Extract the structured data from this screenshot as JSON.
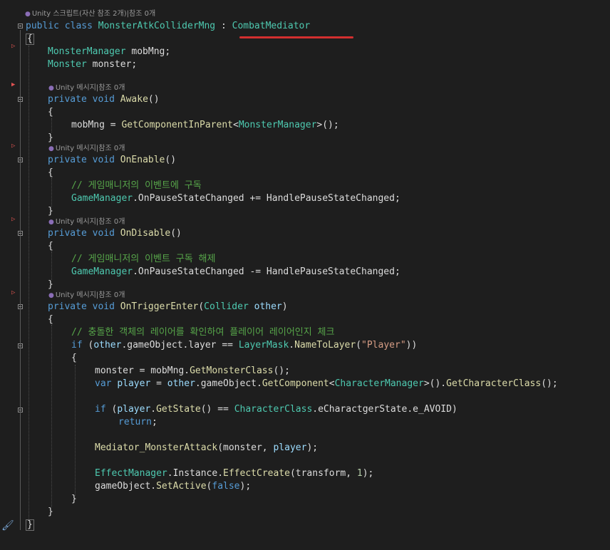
{
  "lens": {
    "script_unity": "Unity",
    "script_rest": "스크립트(자산 참조 2개)|참조 0개",
    "msg_unity": "Unity",
    "msg_rest": "메시지|참조 0개"
  },
  "code": {
    "kw_public": "public",
    "kw_class": "class",
    "class_name": "MonsterAtkColliderMng",
    "colon": " : ",
    "base_class": "CombatMediator",
    "brace_open": "{",
    "brace_close": "}",
    "t_monster_manager": "MonsterManager",
    "f_mobMng": " mobMng;",
    "t_monster": "Monster",
    "f_monster": " monster;",
    "kw_private": "private",
    "kw_void": "void",
    "m_awake": "Awake",
    "parens": "()",
    "awake_body_a": "mobMng = ",
    "awake_call": "GetComponentInParent",
    "lt": "<",
    "gt_call": ">();",
    "m_onenable": "OnEnable",
    "cm_subscribe": "// 게임매니저의 이벤트에 구독",
    "t_game_manager": "GameManager",
    "ev_add": ".OnPauseStateChanged += HandlePauseStateChanged;",
    "m_ondisable": "OnDisable",
    "cm_unsubscribe": "// 게임매니저의 이벤트 구독 해제",
    "ev_remove": ".OnPauseStateChanged -= HandlePauseStateChanged;",
    "m_ontrigger": "OnTriggerEnter",
    "p_open": "(",
    "t_collider": "Collider",
    "p_other": "other",
    "p_close": ")",
    "cm_check": "// 충돌한 객체의 레이어를 확인하여 플레이어 레이어인지 체크",
    "kw_if": "if",
    "if_open": " (",
    "v_other": "other",
    "go_layer": ".gameObject.layer == ",
    "t_layermask": "LayerMask",
    "dot": ".",
    "m_nametolayer": "NameToLayer",
    "str_player": "\"Player\"",
    "close2": "))",
    "assign_monster": "monster = mobMng.",
    "m_getmonsterclass": "GetMonsterClass",
    "end_call": "();",
    "kw_var": "var",
    "v_player": "player",
    "eq": " = ",
    "go_dot": ".gameObject.",
    "m_getcomponent": "GetComponent",
    "t_character_manager": "CharacterManager",
    "gt_paren_dot": ">().",
    "m_getcharacterclass": "GetCharacterClass",
    "m_getstate": "GetState",
    "state_eq": "() == ",
    "t_character_class": "CharacterClass",
    "enum_rest": ".eCharactgerState.e_AVOID)",
    "kw_return": "return",
    "semi": ";",
    "m_mediator": "Mediator_MonsterAttack",
    "args_a": "(monster, ",
    "args_end": ");",
    "t_effect_manager": "EffectManager",
    "instance_dot": ".Instance.",
    "m_effectcreate": "EffectCreate",
    "args_transform": "(transform, ",
    "num_one": "1",
    "go_prefix": "gameObject.",
    "m_setactive": "SetActive",
    "kw_false": "false"
  }
}
